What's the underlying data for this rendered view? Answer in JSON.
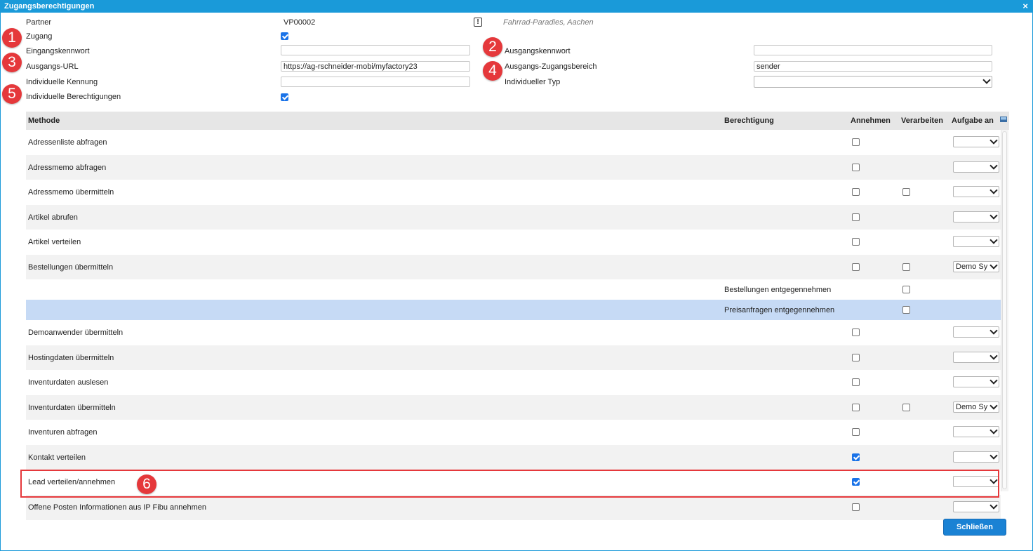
{
  "window": {
    "title": "Zugangsberechtigungen",
    "close_symbol": "×"
  },
  "form": {
    "partner_label": "Partner",
    "partner_value": "VP00002",
    "partner_info_symbol": "!",
    "partner_name": "Fahrrad-Paradies, Aachen",
    "zugang_label": "Zugang",
    "zugang_checked": true,
    "eingangskennwort_label": "Eingangskennwort",
    "eingangskennwort_value": "",
    "ausgangskennwort_label": "Ausgangskennwort",
    "ausgangskennwort_value": "",
    "ausgangs_url_label": "Ausgangs-URL",
    "ausgangs_url_value": "https://ag-rschneider-mobi/myfactory23",
    "ausgangs_zugangsbereich_label": "Ausgangs-Zugangsbereich",
    "ausgangs_zugangsbereich_value": "sender",
    "individuelle_kennung_label": "Individuelle Kennung",
    "individuelle_kennung_value": "",
    "individueller_typ_label": "Individueller Typ",
    "individueller_typ_value": "",
    "individuelle_berechtigungen_label": "Individuelle Berechtigungen",
    "individuelle_berechtigungen_checked": true
  },
  "badges": [
    "1",
    "2",
    "3",
    "4",
    "5",
    "6"
  ],
  "grid": {
    "columns": {
      "methode": "Methode",
      "berechtigung": "Berechtigung",
      "annehmen": "Annehmen",
      "verarbeiten": "Verarbeiten",
      "aufgabe_an": "Aufgabe an"
    },
    "rows": [
      {
        "methode": "Adressenliste abfragen",
        "berechtigung": "",
        "annehmen": false,
        "verarbeiten": null,
        "aufgabe": ""
      },
      {
        "methode": "Adressmemo abfragen",
        "berechtigung": "",
        "annehmen": false,
        "verarbeiten": null,
        "aufgabe": ""
      },
      {
        "methode": "Adressmemo übermitteln",
        "berechtigung": "",
        "annehmen": false,
        "verarbeiten": false,
        "aufgabe": ""
      },
      {
        "methode": "Artikel abrufen",
        "berechtigung": "",
        "annehmen": false,
        "verarbeiten": null,
        "aufgabe": ""
      },
      {
        "methode": "Artikel verteilen",
        "berechtigung": "",
        "annehmen": false,
        "verarbeiten": null,
        "aufgabe": ""
      },
      {
        "methode": "Bestellungen übermitteln",
        "berechtigung": "",
        "annehmen": false,
        "verarbeiten": false,
        "aufgabe": "Demo Sy"
      },
      {
        "methode": "",
        "berechtigung": "Bestellungen entgegennehmen",
        "annehmen": null,
        "verarbeiten": false,
        "aufgabe": null
      },
      {
        "methode": "",
        "berechtigung": "Preisanfragen entgegennehmen",
        "annehmen": null,
        "verarbeiten": false,
        "aufgabe": null
      },
      {
        "methode": "Demoanwender übermitteln",
        "berechtigung": "",
        "annehmen": false,
        "verarbeiten": null,
        "aufgabe": ""
      },
      {
        "methode": "Hostingdaten übermitteln",
        "berechtigung": "",
        "annehmen": false,
        "verarbeiten": null,
        "aufgabe": ""
      },
      {
        "methode": "Inventurdaten auslesen",
        "berechtigung": "",
        "annehmen": false,
        "verarbeiten": null,
        "aufgabe": ""
      },
      {
        "methode": "Inventurdaten übermitteln",
        "berechtigung": "",
        "annehmen": false,
        "verarbeiten": false,
        "aufgabe": "Demo Sy"
      },
      {
        "methode": "Inventuren abfragen",
        "berechtigung": "",
        "annehmen": false,
        "verarbeiten": null,
        "aufgabe": ""
      },
      {
        "methode": "Kontakt verteilen",
        "berechtigung": "",
        "annehmen": true,
        "verarbeiten": null,
        "aufgabe": ""
      },
      {
        "methode": "Lead verteilen/annehmen",
        "berechtigung": "",
        "annehmen": true,
        "verarbeiten": null,
        "aufgabe": ""
      },
      {
        "methode": "Offene Posten Informationen aus IP Fibu annehmen",
        "berechtigung": "",
        "annehmen": false,
        "verarbeiten": null,
        "aufgabe": ""
      }
    ]
  },
  "footer": {
    "close_button_label": "Schließen"
  },
  "colors": {
    "accent": "#1a9ad9",
    "badge": "#e5383b",
    "selected_row": "#c6daf5",
    "button": "#1a82d4"
  }
}
